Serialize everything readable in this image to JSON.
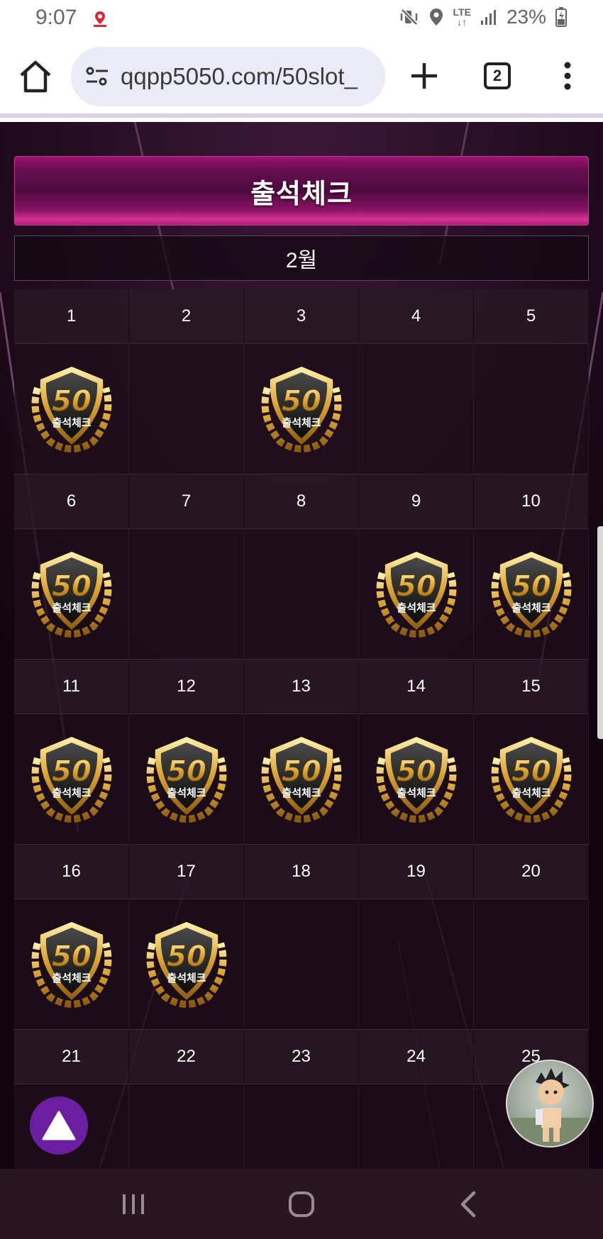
{
  "status_bar": {
    "time": "9:07",
    "battery": "23%",
    "network": "LTE"
  },
  "browser": {
    "url": "qqpp5050.com/50slot_",
    "tab_count": "2"
  },
  "page": {
    "title": "출석체크",
    "month": "2월",
    "badge_text": "출석체크",
    "badge_number": "50",
    "colors": {
      "banner": "#b21b7a",
      "background": "#160712",
      "scroll_up_button": "#6b1fa0"
    }
  },
  "calendar": {
    "weeks": [
      {
        "days": [
          {
            "day": "1",
            "checked": true
          },
          {
            "day": "2",
            "checked": false
          },
          {
            "day": "3",
            "checked": true
          },
          {
            "day": "4",
            "checked": false
          },
          {
            "day": "5",
            "checked": false
          }
        ]
      },
      {
        "days": [
          {
            "day": "6",
            "checked": true
          },
          {
            "day": "7",
            "checked": false
          },
          {
            "day": "8",
            "checked": false
          },
          {
            "day": "9",
            "checked": true
          },
          {
            "day": "10",
            "checked": true
          }
        ]
      },
      {
        "days": [
          {
            "day": "11",
            "checked": true
          },
          {
            "day": "12",
            "checked": true
          },
          {
            "day": "13",
            "checked": true
          },
          {
            "day": "14",
            "checked": true
          },
          {
            "day": "15",
            "checked": true
          }
        ]
      },
      {
        "days": [
          {
            "day": "16",
            "checked": true
          },
          {
            "day": "17",
            "checked": true
          },
          {
            "day": "18",
            "checked": false
          },
          {
            "day": "19",
            "checked": false
          },
          {
            "day": "20",
            "checked": false
          }
        ]
      },
      {
        "days": [
          {
            "day": "21",
            "checked": false
          },
          {
            "day": "22",
            "checked": false
          },
          {
            "day": "23",
            "checked": false
          },
          {
            "day": "24",
            "checked": false
          },
          {
            "day": "25",
            "checked": false
          }
        ]
      }
    ]
  }
}
